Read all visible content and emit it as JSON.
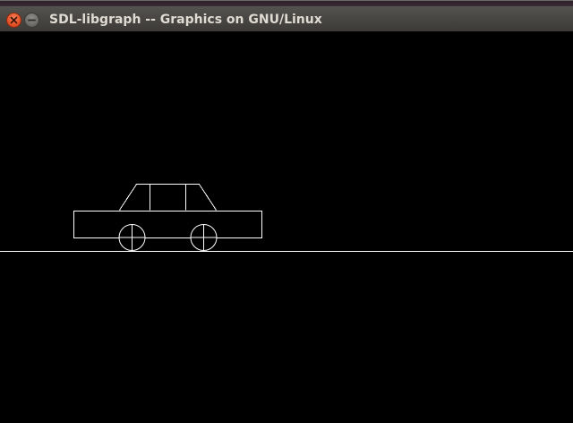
{
  "window": {
    "title": "SDL-libgraph -- Graphics on GNU/Linux",
    "controls": {
      "close_icon": "close-icon",
      "minimize_icon": "minimize-icon"
    }
  },
  "canvas": {
    "background": "#000000",
    "stroke_color": "#ffffff"
  }
}
